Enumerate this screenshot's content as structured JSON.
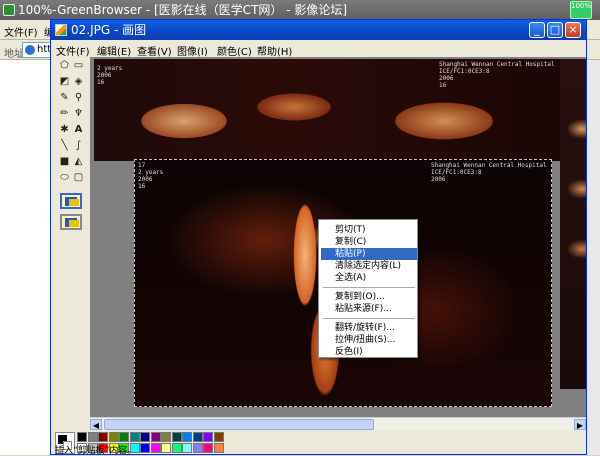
{
  "browser": {
    "title": "100%-GreenBrowser - [医影在线（医学CT网） - 影像论坛]",
    "badge": "100%",
    "menu_file": "文件(F)",
    "menu_partial": "编",
    "address_label": "地址",
    "address_value": "htt"
  },
  "paint": {
    "title": "02.JPG - 画图",
    "window_buttons": {
      "minimize": "_",
      "maximize": "□",
      "close": "×"
    },
    "menu": [
      "文件(F)",
      "编辑(E)",
      "查看(V)",
      "图像(I)",
      "颜色(C)",
      "帮助(H)"
    ],
    "status_text": "插入“剪贴板”内容。"
  },
  "image_text": {
    "top_left": [
      "2 years",
      "2006",
      "16"
    ],
    "top_right": [
      "Shanghai Wennan Central Hospital",
      "ICE/FC1:0CE3:8",
      "2006",
      "16"
    ],
    "front_left": [
      "17",
      "2 years",
      "2006",
      "16"
    ],
    "front_right": [
      "Shanghai Wennan Central Hospital",
      "ICE/FC1:0CE3:8",
      "2006"
    ]
  },
  "context_menu": {
    "items": [
      {
        "label": "剪切(T)",
        "active": false
      },
      {
        "label": "复制(C)",
        "active": false
      },
      {
        "label": "粘贴(P)",
        "active": true
      },
      {
        "label": "清除选定内容(L)",
        "active": false
      },
      {
        "label": "全选(A)",
        "active": false
      },
      {
        "label": "复制到(O)...",
        "active": false
      },
      {
        "label": "粘贴来源(F)...",
        "active": false
      },
      {
        "label": "翻转/旋转(F)...",
        "active": false
      },
      {
        "label": "拉伸/扭曲(S)...",
        "active": false
      },
      {
        "label": "反色(I)",
        "active": false
      }
    ]
  },
  "tools": [
    "free-select",
    "rect-select",
    "eraser",
    "fill",
    "picker",
    "magnifier",
    "pencil",
    "brush",
    "airbrush",
    "text",
    "line",
    "curve",
    "rectangle",
    "polygon",
    "ellipse",
    "rounded-rect"
  ],
  "palette_colors": [
    "#000000",
    "#808080",
    "#800000",
    "#808000",
    "#008000",
    "#008080",
    "#000080",
    "#800080",
    "#808040",
    "#004040",
    "#0080ff",
    "#004080",
    "#8000ff",
    "#804000",
    "#ffffff",
    "#c0c0c0",
    "#ff0000",
    "#ffff00",
    "#00ff00",
    "#00ffff",
    "#0000ff",
    "#ff00ff",
    "#ffff80",
    "#00ff80",
    "#80ffff",
    "#8080ff",
    "#ff0080",
    "#ff8040"
  ],
  "accent_colors": {
    "titlebar": "#0b47c5",
    "menu_highlight": "#316ac5"
  }
}
